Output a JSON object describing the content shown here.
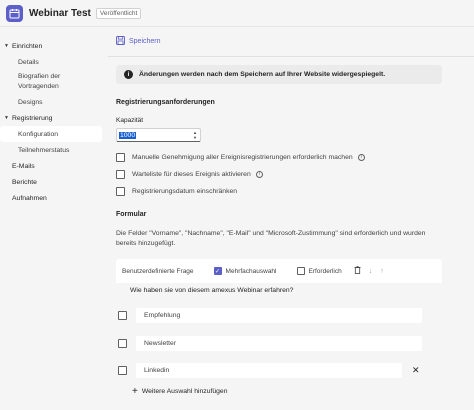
{
  "header": {
    "title": "Webinar Test",
    "status_badge": "Veröffentlicht"
  },
  "sidebar": {
    "items": [
      {
        "label": "Einrichten"
      },
      {
        "label": "Details"
      },
      {
        "label": "Biografien der Vortragenden"
      },
      {
        "label": "Designs"
      },
      {
        "label": "Registrierung"
      },
      {
        "label": "Konfiguration"
      },
      {
        "label": "Teilnehmerstatus"
      },
      {
        "label": "E-Mails"
      },
      {
        "label": "Berichte"
      },
      {
        "label": "Aufnahmen"
      }
    ]
  },
  "toolbar": {
    "save_label": "Speichern"
  },
  "info_bar": {
    "text": "Änderungen werden nach dem Speichern auf Ihrer Website widergespiegelt."
  },
  "registration": {
    "section_title": "Registrierungsanforderungen",
    "capacity_label": "Kapazität",
    "capacity_value": "1000",
    "options": [
      {
        "label": "Manuelle Genehmigung aller Ereignisregistrierungen erforderlich machen",
        "checked": false
      },
      {
        "label": "Warteliste für dieses Ereignis aktivieren",
        "checked": false
      },
      {
        "label": "Registrierungsdatum einschränken",
        "checked": false
      }
    ]
  },
  "form": {
    "section_title": "Formular",
    "description": "Die Felder \"Vorname\", \"Nachname\", \"E-Mail\" und \"Microsoft-Zustimmung\" sind erforderlich und wurden bereits hinzugefügt.",
    "question": {
      "type_label": "Benutzerdefinierte Frage",
      "multiple_choice_label": "Mehrfachauswahl",
      "multiple_choice_checked": true,
      "required_label": "Erforderlich",
      "required_checked": false,
      "text": "Wie haben sie von diesem amexus Webinar erfahren?",
      "answers": [
        "Empfehlung",
        "Newsletter",
        "Linkedin"
      ],
      "add_answer_label": "Weitere Auswahl hinzufügen"
    }
  },
  "colors": {
    "accent": "#5b5fc7",
    "selection": "#1a5fd0"
  },
  "icons": {
    "app": "calendar-icon",
    "save": "save-icon",
    "info": "info-icon",
    "help": "help-icon",
    "delete": "trash-icon",
    "move_down": "arrow-down-icon",
    "move_up": "arrow-up-icon",
    "remove": "close-icon",
    "add": "plus-icon"
  }
}
